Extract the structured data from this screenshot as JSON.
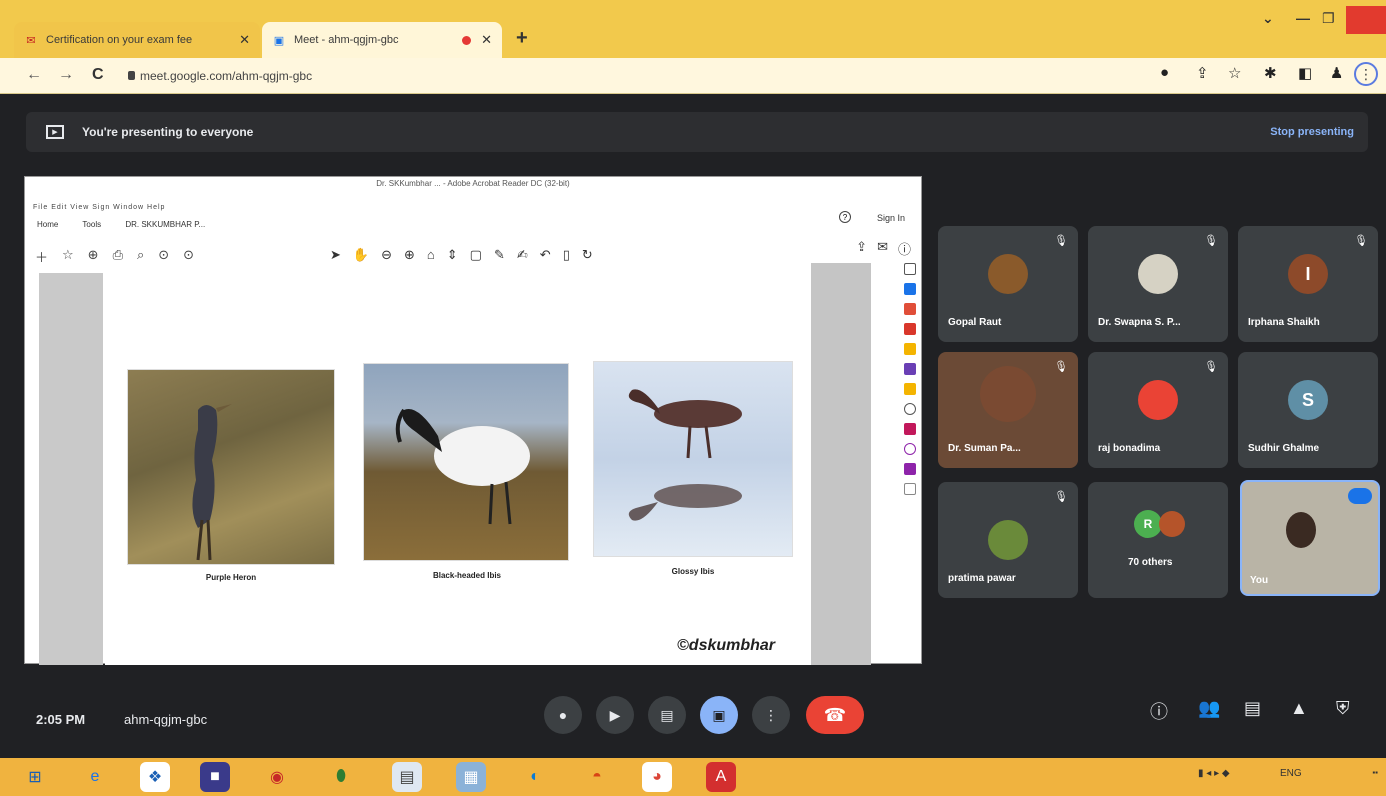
{
  "browser": {
    "tabs": [
      {
        "title": "Certification on your exam fee",
        "icon": "mail-icon"
      },
      {
        "title": "Meet - ahm-qgjm-gbc",
        "icon": "meet-icon"
      }
    ],
    "url": "meet.google.com/ahm-qgjm-gbc"
  },
  "meet": {
    "banner_text": "You're presenting to everyone",
    "stop_label": "Stop presenting",
    "time": "2:05 PM",
    "meeting_code": "ahm-qgjm-gbc"
  },
  "acrobat": {
    "title": "Dr. SKKumbhar ... - Adobe Acrobat Reader DC (32-bit)",
    "tab_home": "Home",
    "tab_tools": "Tools",
    "tab_doc": "DR. SKKUMBHAR P...",
    "sign_in": "Sign In",
    "captions": [
      "Purple Heron",
      "Black-headed Ibis",
      "Glossy Ibis"
    ],
    "watermark": "©dskumbhar"
  },
  "participants": [
    {
      "name": "Gopal Raut",
      "avatar": "",
      "color": "#8a5a2b"
    },
    {
      "name": "Dr. Swapna S. P...",
      "avatar": "",
      "color": "#d6d2c4"
    },
    {
      "name": "Irphana Shaikh",
      "avatar": "I",
      "color": "#8d4a2a"
    },
    {
      "name": "Dr. Suman Pa...",
      "avatar": "",
      "color": "#7a4a32"
    },
    {
      "name": "raj bonadima",
      "avatar": "",
      "color": "#ea4335"
    },
    {
      "name": "Sudhir Ghalme",
      "avatar": "S",
      "color": "#5f8fa6"
    },
    {
      "name": "pratima pawar",
      "avatar": "",
      "color": "#6a8a3a"
    },
    {
      "name": "70 others",
      "avatar": "R",
      "color": "#4caf50"
    },
    {
      "name": "You",
      "avatar": "",
      "color": "#556"
    }
  ]
}
